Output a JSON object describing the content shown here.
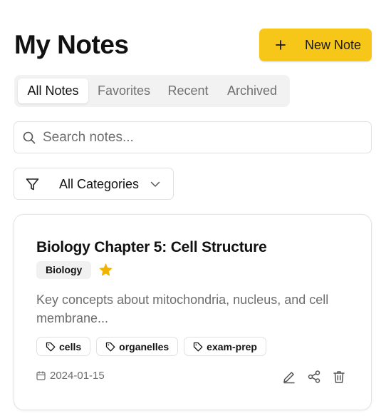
{
  "header": {
    "title": "My Notes",
    "new_note_label": "New Note",
    "new_note_icon": "plus-icon"
  },
  "tabs": [
    {
      "label": "All Notes",
      "active": true
    },
    {
      "label": "Favorites",
      "active": false
    },
    {
      "label": "Recent",
      "active": false
    },
    {
      "label": "Archived",
      "active": false
    }
  ],
  "search": {
    "placeholder": "Search notes...",
    "value": "",
    "icon": "search-icon"
  },
  "filter": {
    "selected": "All Categories",
    "icon": "funnel-icon"
  },
  "notes": [
    {
      "title": "Biology Chapter 5: Cell Structure",
      "category": "Biology",
      "favorite": true,
      "excerpt": "Key concepts about mitochondria, nucleus, and cell membrane...",
      "tags": [
        "cells",
        "organelles",
        "exam-prep"
      ],
      "date": "2024-01-15",
      "actions": [
        "edit-icon",
        "share-icon",
        "trash-icon"
      ]
    }
  ],
  "colors": {
    "accent": "#f6c619",
    "star": "#f0b400",
    "muted_text": "#6d6d6d",
    "border": "#e1e1e1"
  }
}
